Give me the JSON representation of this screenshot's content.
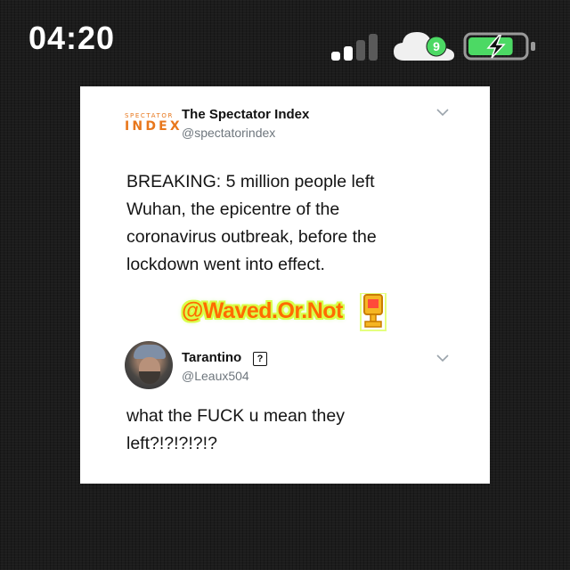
{
  "status_bar": {
    "time": "04:20",
    "signal_bars": 4,
    "signal_active_bars": 2,
    "notification_count": "9",
    "battery_level": 0.8,
    "battery_charging": true,
    "battery_color": "#4cd964"
  },
  "tweet": {
    "logo_small": "SPECTATOR",
    "logo_big": "INDEX",
    "author_name": "The Spectator Index",
    "author_handle": "@spectatorindex",
    "lines": [
      "BREAKING: 5 million people left",
      "Wuhan, the epicentre of the",
      "coronavirus outbreak, before the",
      "lockdown went into effect."
    ]
  },
  "watermark": {
    "text": "@Waved.Or.Not"
  },
  "reply": {
    "author_name": "Tarantino",
    "badge": "?",
    "author_handle": "@Leaux504",
    "lines": [
      "what the FUCK u mean they",
      "left?!?!?!?!?"
    ]
  }
}
